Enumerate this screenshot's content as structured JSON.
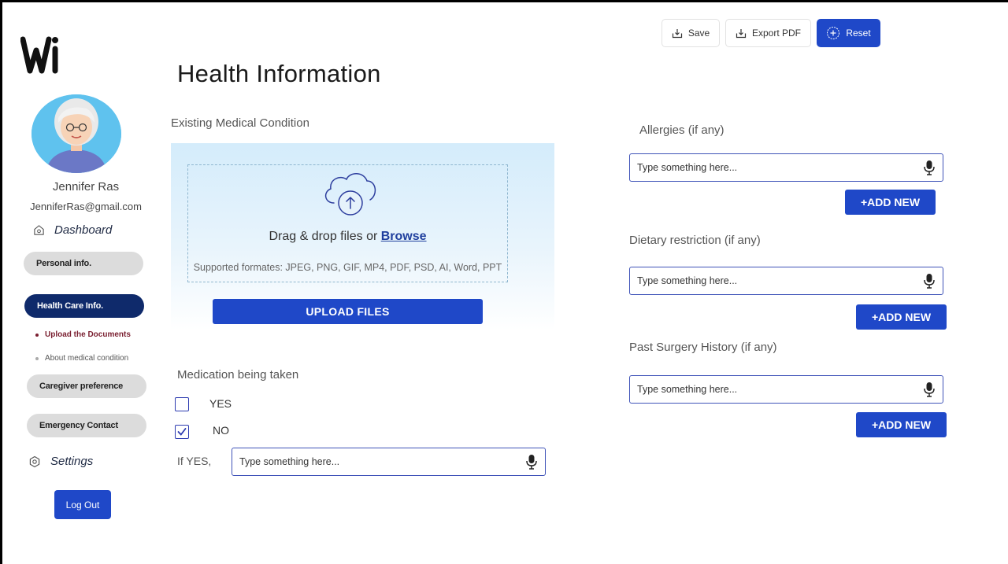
{
  "brand": {
    "logo_text": "Wi",
    "accent": "#1f48c8",
    "nav_active": "#0f2a6b"
  },
  "user": {
    "name": "Jennifer Ras",
    "email": "JenniferRas@gmail.com"
  },
  "sidebar": {
    "dashboard": {
      "label": "Dashboard",
      "icon": "home-icon"
    },
    "items": [
      {
        "label": "Personal info."
      },
      {
        "label": "Health Care Info.",
        "active": true
      },
      {
        "label": "Caregiver preference"
      },
      {
        "label": "Emergency Contact"
      }
    ],
    "subitems": [
      {
        "label": "Upload the Documents",
        "active": true
      },
      {
        "label": "About medical condition"
      }
    ],
    "settings": {
      "label": "Settings",
      "icon": "gear-icon"
    },
    "logout_label": "Log Out"
  },
  "toolbar": {
    "save_label": "Save",
    "export_label": "Export PDF",
    "reset_label": "Reset"
  },
  "page": {
    "title": "Health Information"
  },
  "upload": {
    "section_label": "Existing Medical Condition",
    "drag_text": "Drag & drop files or ",
    "browse_label": "Browse",
    "formats": "Supported formates: JPEG, PNG, GIF, MP4, PDF, PSD, AI, Word, PPT",
    "button_label": "UPLOAD FILES"
  },
  "medication": {
    "section_label": "Medication being taken",
    "yes_label": "YES",
    "no_label": "NO",
    "yes_checked": false,
    "no_checked": true,
    "if_yes_label": "If YES,",
    "placeholder": "Type something here..."
  },
  "allergies": {
    "label": "Allergies (if any)",
    "placeholder": "Type something here...",
    "add_label": "+ADD NEW"
  },
  "dietary": {
    "label": "Dietary restriction (if any)",
    "placeholder": "Type something here...",
    "add_label": "+ADD NEW"
  },
  "surgery": {
    "label": "Past Surgery History (if any)",
    "placeholder": "Type something here...",
    "add_label": "+ADD NEW"
  }
}
